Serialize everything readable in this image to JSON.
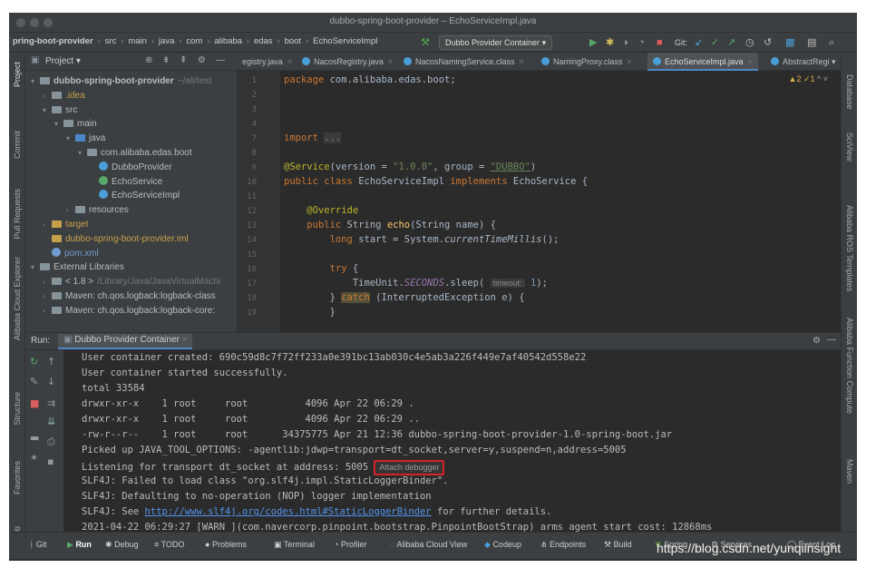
{
  "window": {
    "title": "dubbo-spring-boot-provider – EchoServiceImpl.java"
  },
  "navbar": {
    "breadcrumbs": [
      "pring-boot-provider",
      "src",
      "main",
      "java",
      "com",
      "alibaba",
      "edas",
      "boot",
      "EchoServiceImpl"
    ],
    "run_config": "Dubbo Provider Container",
    "git_label": "Git:"
  },
  "left_stripe": [
    "Project",
    "Commit",
    "Pull Requests",
    "Alibaba Cloud Explorer",
    "Structure",
    "Favorites",
    "Web"
  ],
  "right_stripe": [
    "Database",
    "SciView",
    "Alibaba ROS Templates",
    "Alibaba Function Compute",
    "Maven"
  ],
  "project": {
    "header": "Project",
    "tree": [
      {
        "label": "dubbo-spring-boot-provider",
        "suffix": "~/ali/test",
        "depth": 0,
        "arrow": "▾",
        "kind": "module"
      },
      {
        "label": ".idea",
        "depth": 1,
        "arrow": "›",
        "kind": "folder",
        "color": "#c5a04a"
      },
      {
        "label": "src",
        "depth": 1,
        "arrow": "▾",
        "kind": "folder"
      },
      {
        "label": "main",
        "depth": 2,
        "arrow": "▾",
        "kind": "folder"
      },
      {
        "label": "java",
        "depth": 3,
        "arrow": "▾",
        "kind": "folder-blue"
      },
      {
        "label": "com.alibaba.edas.boot",
        "depth": 4,
        "arrow": "▾",
        "kind": "package"
      },
      {
        "label": "DubboProvider",
        "depth": 5,
        "kind": "class-boot"
      },
      {
        "label": "EchoService",
        "depth": 5,
        "kind": "interface"
      },
      {
        "label": "EchoServiceImpl",
        "depth": 5,
        "kind": "class"
      },
      {
        "label": "resources",
        "depth": 3,
        "arrow": "›",
        "kind": "folder"
      },
      {
        "label": "target",
        "depth": 1,
        "arrow": "›",
        "kind": "folder-orange",
        "color": "#c5a04a"
      },
      {
        "label": "dubbo-spring-boot-provider.iml",
        "depth": 1,
        "kind": "iml",
        "color": "#c5a04a"
      },
      {
        "label": "pom.xml",
        "depth": 1,
        "kind": "maven",
        "color": "#6e9ccf"
      },
      {
        "label": "External Libraries",
        "depth": 0,
        "arrow": "▾",
        "kind": "libs"
      },
      {
        "label": "< 1.8 >",
        "suffix": "/Library/Java/JavaVirtualMachi",
        "depth": 1,
        "arrow": "›",
        "kind": "jdk"
      },
      {
        "label": "Maven: ch.qos.logback:logback-class",
        "depth": 1,
        "arrow": "›",
        "kind": "jar"
      },
      {
        "label": "Maven: ch.qos.logback:logback-core:",
        "depth": 1,
        "arrow": "›",
        "kind": "jar"
      }
    ]
  },
  "editor": {
    "tabs": [
      {
        "label": "egistry.java",
        "active": false
      },
      {
        "label": "NacosRegistry.java",
        "active": false
      },
      {
        "label": "NacosNamingService.class",
        "active": false
      },
      {
        "label": "NamingProxy.class",
        "active": false
      },
      {
        "label": "EchoServiceImpl.java",
        "active": true
      },
      {
        "label": "AbstractRegi",
        "active": false
      }
    ],
    "warnings": "▲2 ✓1",
    "line_numbers": [
      "1",
      "2",
      "3",
      "4",
      "7",
      "8",
      "9",
      "10",
      "11",
      "12",
      "13",
      "14",
      "15",
      "16",
      "17",
      "18",
      "19"
    ]
  },
  "run_panel": {
    "label": "Run:",
    "tab": "Dubbo Provider Container",
    "console": [
      "User container created: 690c59d8c7f72ff233a0e391bc13ab030c4e5ab3a226f449e7af40542d558e22",
      "User container started successfully.",
      "total 33584",
      "drwxr-xr-x    1 root     root          4096 Apr 22 06:29 .",
      "drwxr-xr-x    1 root     root          4096 Apr 22 06:29 ..",
      "-rw-r--r--    1 root     root      34375775 Apr 21 12:36 dubbo-spring-boot-provider-1.0-spring-boot.jar",
      "Picked up JAVA_TOOL_OPTIONS: -agentlib:jdwp=transport=dt_socket,server=y,suspend=n,address=5005",
      "Listening for transport dt_socket at address: 5005",
      "SLF4J: Failed to load class \"org.slf4j.impl.StaticLoggerBinder\".",
      "SLF4J: Defaulting to no-operation (NOP) logger implementation",
      "SLF4J: See ",
      "2021-04-22 06:29:27 [WARN ](com.navercorp.pinpoint.bootstrap.PinpointBootStrap) arms agent start cost: 12868ms"
    ],
    "attach_label": "Attach debugger",
    "link": "http://www.slf4j.org/codes.html#StaticLoggerBinder",
    "link_suffix": " for further details."
  },
  "bottom_bar": [
    "Git",
    "Run",
    "Debug",
    "TODO",
    "Problems",
    "Terminal",
    "Profiler",
    "Alibaba Cloud View",
    "Codeup",
    "Endpoints",
    "Build",
    "Spring",
    "Services",
    "Event Log"
  ],
  "watermark": "https://blog.csdn.net/yunqiinsight",
  "colors": {
    "accent": "#4a88c7",
    "highlight_box": "#d9202b",
    "keyword": "#cc7832",
    "string": "#6a8759",
    "annotation": "#bbb529"
  }
}
